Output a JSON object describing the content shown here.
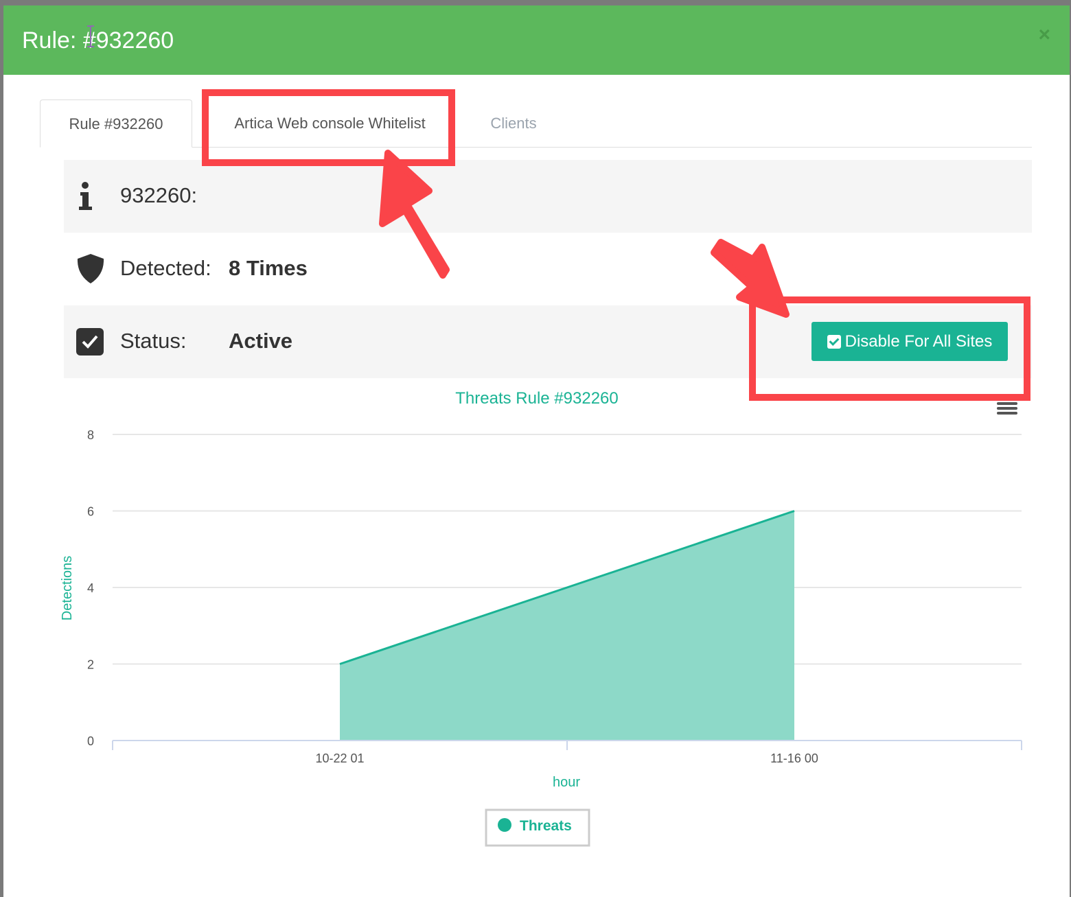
{
  "modal": {
    "title": "Rule: #932260"
  },
  "tabs": [
    {
      "label": "Rule #932260"
    },
    {
      "label": "Artica Web console Whitelist"
    },
    {
      "label": "Clients"
    }
  ],
  "info": {
    "label": "932260:"
  },
  "detected": {
    "label": "Detected:",
    "value": "8 Times"
  },
  "status": {
    "label": "Status:",
    "value": "Active",
    "button": "Disable For All Sites"
  },
  "colors": {
    "header": "#5cb85c",
    "accent": "#1ab394",
    "highlight": "#fa4449"
  },
  "chart_data": {
    "type": "area",
    "title": "Threats Rule #932260",
    "xlabel": "hour",
    "ylabel": "Detections",
    "x": [
      "10-22 01",
      "11-16 00"
    ],
    "series": [
      {
        "name": "Threats",
        "values": [
          2,
          6
        ]
      }
    ],
    "ylim": [
      0,
      8
    ],
    "yticks": [
      0,
      2,
      4,
      6,
      8
    ],
    "grid": true,
    "legend": "bottom-center"
  }
}
